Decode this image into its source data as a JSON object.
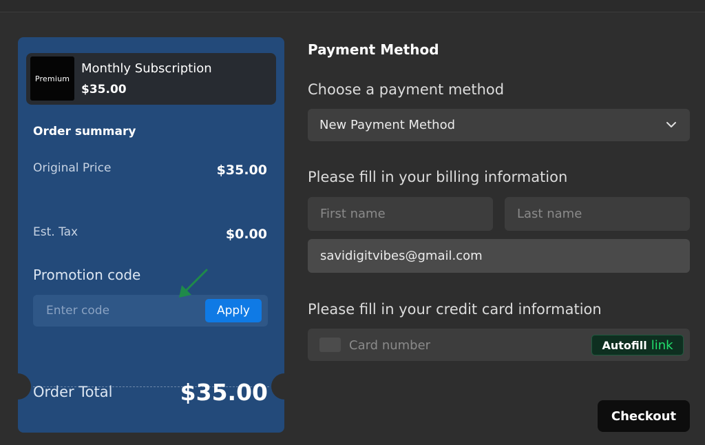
{
  "product": {
    "logo_text": "Premium",
    "name": "Monthly Subscription",
    "price": "$35.00"
  },
  "summary": {
    "title": "Order summary",
    "original_price_label": "Original Price",
    "original_price_value": "$35.00",
    "tax_label": "Est. Tax",
    "tax_value": "$0.00",
    "promo_label": "Promotion code",
    "promo_placeholder": "Enter code",
    "apply_label": "Apply",
    "total_label": "Order Total",
    "total_value": "$35.00"
  },
  "payment": {
    "title": "Payment Method",
    "choose_label": "Choose a payment method",
    "selected_method": "New Payment Method",
    "billing_label": "Please fill in your billing information",
    "first_name_placeholder": "First name",
    "last_name_placeholder": "Last name",
    "email_value": "savidigitvibes@gmail.com",
    "card_label": "Please fill in your credit card information",
    "card_placeholder": "Card number",
    "autofill_label": "Autofill",
    "link_label": "link",
    "checkout_label": "Checkout"
  },
  "colors": {
    "card_bg": "#234a7a",
    "apply_button": "#0f7ae5",
    "link_green": "#22e06d",
    "annotation_arrow": "#1f8a4a"
  }
}
